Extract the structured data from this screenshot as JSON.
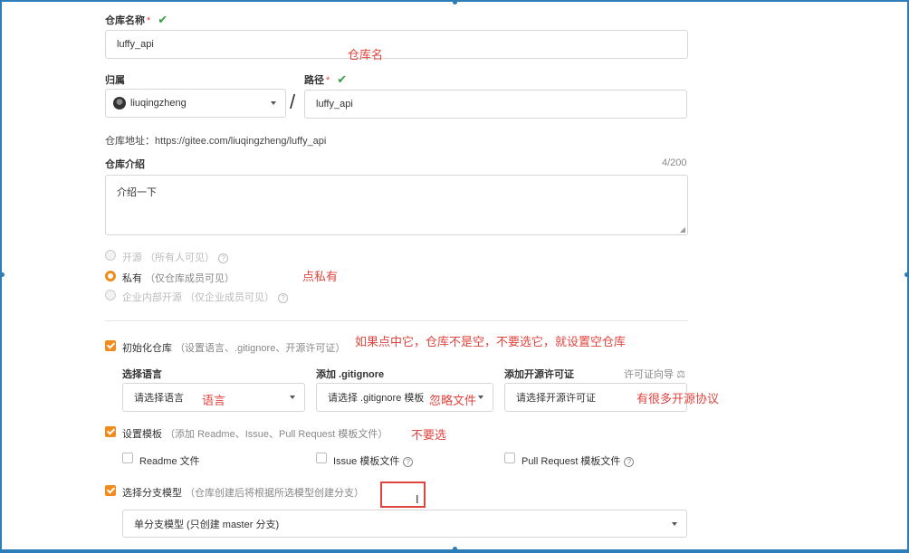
{
  "repo_name": {
    "label": "仓库名称",
    "required_mark": "*",
    "value": "luffy_api",
    "annotation": "仓库名"
  },
  "owner": {
    "label": "归属",
    "value": "liuqingzheng"
  },
  "separator": "/",
  "path": {
    "label": "路径",
    "required_mark": "*",
    "value": "luffy_api"
  },
  "repo_address": "仓库地址：https://gitee.com/liuqingzheng/luffy_api",
  "intro": {
    "label": "仓库介绍",
    "counter": "4/200",
    "value": "介绍一下"
  },
  "visibility": {
    "options": [
      {
        "label": "开源",
        "hint": "（所有人可见）"
      },
      {
        "label": "私有",
        "hint": "（仅仓库成员可见）"
      },
      {
        "label": "企业内部开源",
        "hint": "（仅企业成员可见）"
      }
    ],
    "annotation": "点私有"
  },
  "init_repo": {
    "label": "初始化仓库",
    "hint": "（设置语言、.gitignore、开源许可证）",
    "annotation": "如果点中它，仓库不是空，不要选它，就设置空仓库"
  },
  "language": {
    "label": "选择语言",
    "placeholder": "请选择语言",
    "annotation": "语言"
  },
  "gitignore": {
    "label": "添加 .gitignore",
    "placeholder": "请选择 .gitignore 模板",
    "annotation": "忽略文件"
  },
  "license": {
    "label": "添加开源许可证",
    "guide": "许可证向导",
    "placeholder": "请选择开源许可证",
    "annotation": "有很多开源协议"
  },
  "template": {
    "label": "设置模板",
    "hint": "（添加 Readme、Issue、Pull Request 模板文件）",
    "annotation": "不要选",
    "options": [
      "Readme 文件",
      "Issue 模板文件",
      "Pull Request 模板文件"
    ]
  },
  "branch": {
    "label": "选择分支模型",
    "hint": "（仓库创建后将根据所选模型创建分支）",
    "value": "单分支模型 (只创建 master 分支)"
  },
  "colors": {
    "accent": "#f08c1d",
    "annotation": "#e0443e",
    "check": "#3c9a45",
    "frame": "#2d7eb8"
  }
}
